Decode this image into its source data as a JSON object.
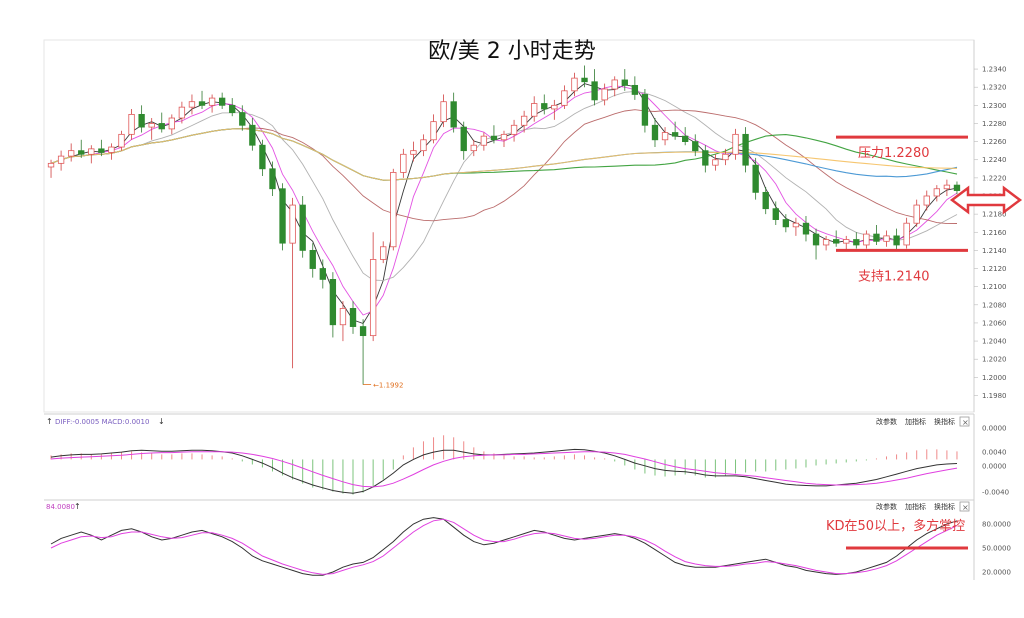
{
  "chart_data": {
    "type": "candlestick",
    "title": "欧/美  2 小时走势",
    "main_panel": {
      "y_ticks": [
        "1.2340",
        "1.2320",
        "1.2300",
        "1.2280",
        "1.2260",
        "1.2240",
        "1.2220",
        "1.2200",
        "1.2180",
        "1.2160",
        "1.2140",
        "1.2120",
        "1.2100",
        "1.2080",
        "1.2060",
        "1.2040",
        "1.2020",
        "1.2000",
        "1.1980"
      ],
      "ylim": [
        1.1975,
        1.235
      ],
      "low_marker": "1.1992",
      "low_value": 1.1992,
      "resistance": {
        "label": "压力1.2280",
        "value": 1.2265,
        "color": "#e0393e"
      },
      "support": {
        "label": "支持1.2140",
        "value": 1.214,
        "color": "#e0393e"
      },
      "candles": [
        [
          1.2232,
          1.224,
          1.222,
          1.2236
        ],
        [
          1.2236,
          1.225,
          1.2228,
          1.2244
        ],
        [
          1.2244,
          1.2258,
          1.2238,
          1.225
        ],
        [
          1.225,
          1.2262,
          1.2242,
          1.2246
        ],
        [
          1.2246,
          1.2256,
          1.2236,
          1.2252
        ],
        [
          1.2252,
          1.2262,
          1.2244,
          1.2248
        ],
        [
          1.2248,
          1.2258,
          1.224,
          1.2254
        ],
        [
          1.2254,
          1.2272,
          1.225,
          1.2268
        ],
        [
          1.2268,
          1.2296,
          1.2262,
          1.229
        ],
        [
          1.229,
          1.23,
          1.227,
          1.2276
        ],
        [
          1.2276,
          1.2286,
          1.2262,
          1.228
        ],
        [
          1.228,
          1.2292,
          1.227,
          1.2274
        ],
        [
          1.2274,
          1.229,
          1.2268,
          1.2286
        ],
        [
          1.2286,
          1.2304,
          1.228,
          1.2298
        ],
        [
          1.2298,
          1.2312,
          1.229,
          1.2304
        ],
        [
          1.2304,
          1.2316,
          1.2296,
          1.23
        ],
        [
          1.23,
          1.2312,
          1.2292,
          1.2308
        ],
        [
          1.2308,
          1.2314,
          1.2296,
          1.23
        ],
        [
          1.23,
          1.2308,
          1.2288,
          1.2292
        ],
        [
          1.2292,
          1.23,
          1.2272,
          1.2278
        ],
        [
          1.2278,
          1.2286,
          1.225,
          1.2256
        ],
        [
          1.2256,
          1.2262,
          1.2222,
          1.223
        ],
        [
          1.223,
          1.2238,
          1.22,
          1.2208
        ],
        [
          1.2208,
          1.2214,
          1.214,
          1.2148
        ],
        [
          1.2148,
          1.2198,
          1.201,
          1.219
        ],
        [
          1.219,
          1.22,
          1.2132,
          1.214
        ],
        [
          1.214,
          1.2148,
          1.211,
          1.212
        ],
        [
          1.212,
          1.213,
          1.2098,
          1.2108
        ],
        [
          1.2108,
          1.2116,
          1.2044,
          1.2058
        ],
        [
          1.2058,
          1.2084,
          1.204,
          1.2076
        ],
        [
          1.2076,
          1.2084,
          1.2048,
          1.2056
        ],
        [
          1.2056,
          1.2064,
          1.1992,
          1.2046
        ],
        [
          1.2046,
          1.216,
          1.204,
          1.213
        ],
        [
          1.213,
          1.215,
          1.2126,
          1.2144
        ],
        [
          1.2144,
          1.223,
          1.214,
          1.2226
        ],
        [
          1.2226,
          1.2252,
          1.222,
          1.2246
        ],
        [
          1.2246,
          1.226,
          1.2238,
          1.225
        ],
        [
          1.225,
          1.2268,
          1.2244,
          1.2262
        ],
        [
          1.2262,
          1.229,
          1.2258,
          1.2282
        ],
        [
          1.2282,
          1.2312,
          1.2276,
          1.2304
        ],
        [
          1.2304,
          1.2314,
          1.227,
          1.2276
        ],
        [
          1.2276,
          1.2282,
          1.224,
          1.225
        ],
        [
          1.225,
          1.2262,
          1.2244,
          1.2256
        ],
        [
          1.2256,
          1.227,
          1.225,
          1.2266
        ],
        [
          1.2266,
          1.2278,
          1.2258,
          1.2262
        ],
        [
          1.2262,
          1.2272,
          1.2254,
          1.2268
        ],
        [
          1.2268,
          1.2284,
          1.226,
          1.2278
        ],
        [
          1.2278,
          1.2294,
          1.227,
          1.2288
        ],
        [
          1.2288,
          1.231,
          1.2282,
          1.2302
        ],
        [
          1.2302,
          1.2312,
          1.229,
          1.2296
        ],
        [
          1.2296,
          1.2306,
          1.2284,
          1.23
        ],
        [
          1.23,
          1.2322,
          1.2296,
          1.2316
        ],
        [
          1.2316,
          1.2336,
          1.231,
          1.233
        ],
        [
          1.233,
          1.2344,
          1.232,
          1.2326
        ],
        [
          1.2326,
          1.234,
          1.23,
          1.2306
        ],
        [
          1.2306,
          1.2324,
          1.23,
          1.2318
        ],
        [
          1.2318,
          1.2332,
          1.231,
          1.2328
        ],
        [
          1.2328,
          1.234,
          1.2316,
          1.2322
        ],
        [
          1.2322,
          1.2332,
          1.2306,
          1.2312
        ],
        [
          1.2312,
          1.2318,
          1.227,
          1.2278
        ],
        [
          1.2278,
          1.2286,
          1.2254,
          1.2262
        ],
        [
          1.2262,
          1.2276,
          1.2256,
          1.227
        ],
        [
          1.227,
          1.2282,
          1.2262,
          1.2266
        ],
        [
          1.2266,
          1.2276,
          1.2256,
          1.226
        ],
        [
          1.226,
          1.2268,
          1.2244,
          1.225
        ],
        [
          1.225,
          1.2256,
          1.2226,
          1.2234
        ],
        [
          1.2234,
          1.2246,
          1.2228,
          1.224
        ],
        [
          1.224,
          1.2252,
          1.2234,
          1.2246
        ],
        [
          1.2246,
          1.2274,
          1.224,
          1.2268
        ],
        [
          1.2268,
          1.2276,
          1.2226,
          1.2234
        ],
        [
          1.2234,
          1.2242,
          1.2196,
          1.2204
        ],
        [
          1.2204,
          1.221,
          1.218,
          1.2186
        ],
        [
          1.2186,
          1.2194,
          1.2168,
          1.2174
        ],
        [
          1.2174,
          1.218,
          1.216,
          1.2166
        ],
        [
          1.2166,
          1.2176,
          1.2156,
          1.217
        ],
        [
          1.217,
          1.2178,
          1.215,
          1.2158
        ],
        [
          1.2158,
          1.2164,
          1.213,
          1.2146
        ],
        [
          1.2146,
          1.2156,
          1.214,
          1.2152
        ],
        [
          1.2152,
          1.2162,
          1.2144,
          1.2148
        ],
        [
          1.2148,
          1.2156,
          1.214,
          1.2152
        ],
        [
          1.2152,
          1.216,
          1.2142,
          1.2146
        ],
        [
          1.2146,
          1.2162,
          1.2142,
          1.2158
        ],
        [
          1.2158,
          1.2168,
          1.2146,
          1.215
        ],
        [
          1.215,
          1.2162,
          1.2144,
          1.2156
        ],
        [
          1.2156,
          1.2164,
          1.214,
          1.2146
        ],
        [
          1.2146,
          1.2176,
          1.2142,
          1.217
        ],
        [
          1.217,
          1.2196,
          1.2166,
          1.219
        ],
        [
          1.219,
          1.2206,
          1.2184,
          1.22
        ],
        [
          1.22,
          1.2212,
          1.2194,
          1.2208
        ],
        [
          1.2208,
          1.2218,
          1.22,
          1.2212
        ],
        [
          1.2212,
          1.2216,
          1.2202,
          1.2206
        ]
      ],
      "ma_colors": [
        "#222222",
        "#e040e0",
        "#a8a8a8",
        "#b45c5c",
        "#2f9a2f",
        "#3a8fd0",
        "#f5c060"
      ]
    },
    "macd_panel": {
      "header": "DIFF:-0.0005  MACD:0.0010",
      "y_ticks": [
        "0.0000",
        "0.0040",
        "0.0000",
        "-0.0040"
      ],
      "buttons": [
        "改参数",
        "加指标",
        "换指标"
      ],
      "histogram": [
        0.0004,
        0.0005,
        0.0006,
        0.0006,
        0.0005,
        0.0005,
        0.0006,
        0.0007,
        0.0008,
        0.0007,
        0.0006,
        0.0005,
        0.0005,
        0.0006,
        0.0006,
        0.0005,
        0.0004,
        0.0003,
        0.0001,
        -0.0002,
        -0.0005,
        -0.0008,
        -0.0012,
        -0.0016,
        -0.002,
        -0.0024,
        -0.0028,
        -0.003,
        -0.0032,
        -0.0034,
        -0.0035,
        -0.0033,
        -0.0028,
        -0.002,
        -0.001,
        0.0004,
        0.0012,
        0.0018,
        0.0022,
        0.0024,
        0.0022,
        0.0018,
        0.0012,
        0.0008,
        0.0006,
        0.0004,
        0.0003,
        0.0003,
        0.0002,
        0.0002,
        0.0003,
        0.0004,
        0.0005,
        0.0004,
        0.0002,
        0.0001,
        -0.0002,
        -0.0006,
        -0.001,
        -0.0014,
        -0.0016,
        -0.0017,
        -0.0016,
        -0.0015,
        -0.0016,
        -0.0018,
        -0.0018,
        -0.0016,
        -0.0014,
        -0.0013,
        -0.0012,
        -0.0012,
        -0.0011,
        -0.001,
        -0.0009,
        -0.0008,
        -0.0006,
        -0.0005,
        -0.0004,
        -0.0003,
        -0.0002,
        -0.0001,
        0.0001,
        0.0003,
        0.0005,
        0.0007,
        0.0009,
        0.001,
        0.001,
        0.0009,
        0.0008
      ],
      "diff": [
        0.0005,
        0.0008,
        0.001,
        0.0011,
        0.0011,
        0.0012,
        0.0014,
        0.0016,
        0.0019,
        0.002,
        0.0019,
        0.0018,
        0.0018,
        0.0019,
        0.002,
        0.002,
        0.0019,
        0.0017,
        0.0014,
        0.0008,
        0.0,
        -0.0008,
        -0.0018,
        -0.003,
        -0.004,
        -0.0048,
        -0.0056,
        -0.0062,
        -0.0068,
        -0.0072,
        -0.0074,
        -0.007,
        -0.006,
        -0.0046,
        -0.003,
        -0.0012,
        0.0,
        0.001,
        0.0016,
        0.002,
        0.002,
        0.0016,
        0.0012,
        0.001,
        0.001,
        0.0011,
        0.0012,
        0.0013,
        0.0014,
        0.0016,
        0.0018,
        0.002,
        0.0022,
        0.0021,
        0.0018,
        0.0014,
        0.0008,
        0.0,
        -0.0008,
        -0.0014,
        -0.002,
        -0.0024,
        -0.0026,
        -0.0027,
        -0.003,
        -0.0034,
        -0.0036,
        -0.0036,
        -0.0036,
        -0.0038,
        -0.0042,
        -0.0046,
        -0.005,
        -0.0054,
        -0.0056,
        -0.0057,
        -0.0058,
        -0.0058,
        -0.0056,
        -0.0054,
        -0.0052,
        -0.0048,
        -0.0044,
        -0.0038,
        -0.0032,
        -0.0026,
        -0.002,
        -0.0016,
        -0.0012,
        -0.001,
        -0.0009
      ],
      "dea": [
        0.0001,
        0.0003,
        0.0004,
        0.0005,
        0.0006,
        0.0007,
        0.0008,
        0.0009,
        0.0011,
        0.0013,
        0.0014,
        0.0015,
        0.0015,
        0.0016,
        0.0017,
        0.0017,
        0.0017,
        0.0017,
        0.0016,
        0.0014,
        0.0011,
        0.0007,
        0.0002,
        -0.0004,
        -0.0011,
        -0.0019,
        -0.0027,
        -0.0035,
        -0.0042,
        -0.0049,
        -0.0055,
        -0.0059,
        -0.006,
        -0.0058,
        -0.0052,
        -0.0043,
        -0.0033,
        -0.0022,
        -0.0012,
        -0.0004,
        0.0002,
        0.0006,
        0.0008,
        0.0009,
        0.001,
        0.001,
        0.0011,
        0.0011,
        0.0012,
        0.0013,
        0.0014,
        0.0015,
        0.0016,
        0.0017,
        0.0017,
        0.0016,
        0.0014,
        0.0011,
        0.0006,
        0.0001,
        -0.0005,
        -0.0011,
        -0.0016,
        -0.002,
        -0.0023,
        -0.0026,
        -0.0029,
        -0.0031,
        -0.0033,
        -0.0035,
        -0.0037,
        -0.004,
        -0.0043,
        -0.0046,
        -0.0049,
        -0.0052,
        -0.0054,
        -0.0055,
        -0.0056,
        -0.0056,
        -0.0055,
        -0.0054,
        -0.0052,
        -0.0049,
        -0.0045,
        -0.0041,
        -0.0036,
        -0.0031,
        -0.0027,
        -0.0023,
        -0.0019
      ]
    },
    "kd_panel": {
      "header": "84.0080",
      "y_ticks": [
        "80.0000",
        "50.0000",
        "20.0000"
      ],
      "buttons": [
        "改参数",
        "加指标",
        "换指标"
      ],
      "annotation": "KD在50以上，多方掌控",
      "level_50": 50,
      "k": [
        55,
        62,
        66,
        70,
        66,
        60,
        66,
        72,
        74,
        70,
        64,
        60,
        62,
        66,
        70,
        72,
        68,
        64,
        58,
        50,
        40,
        34,
        30,
        26,
        22,
        18,
        16,
        16,
        20,
        26,
        30,
        32,
        38,
        48,
        58,
        70,
        80,
        86,
        88,
        86,
        76,
        66,
        58,
        54,
        56,
        60,
        64,
        68,
        72,
        70,
        66,
        62,
        60,
        62,
        64,
        66,
        68,
        66,
        62,
        56,
        48,
        40,
        32,
        28,
        26,
        26,
        26,
        28,
        30,
        32,
        34,
        36,
        32,
        28,
        26,
        22,
        20,
        18,
        17,
        18,
        20,
        24,
        28,
        32,
        40,
        50,
        60,
        68,
        74,
        80,
        84
      ],
      "d": [
        50,
        56,
        60,
        64,
        65,
        63,
        64,
        68,
        70,
        70,
        67,
        64,
        62,
        63,
        66,
        69,
        69,
        66,
        62,
        56,
        48,
        40,
        35,
        30,
        26,
        22,
        19,
        17,
        18,
        22,
        26,
        29,
        33,
        40,
        50,
        60,
        70,
        78,
        84,
        86,
        82,
        74,
        66,
        60,
        58,
        58,
        61,
        65,
        68,
        69,
        68,
        65,
        62,
        61,
        62,
        64,
        66,
        66,
        64,
        60,
        54,
        46,
        39,
        33,
        30,
        28,
        27,
        27,
        28,
        30,
        31,
        33,
        32,
        30,
        28,
        25,
        22,
        20,
        18,
        18,
        19,
        21,
        24,
        28,
        34,
        42,
        50,
        58,
        66,
        72,
        78
      ]
    }
  }
}
